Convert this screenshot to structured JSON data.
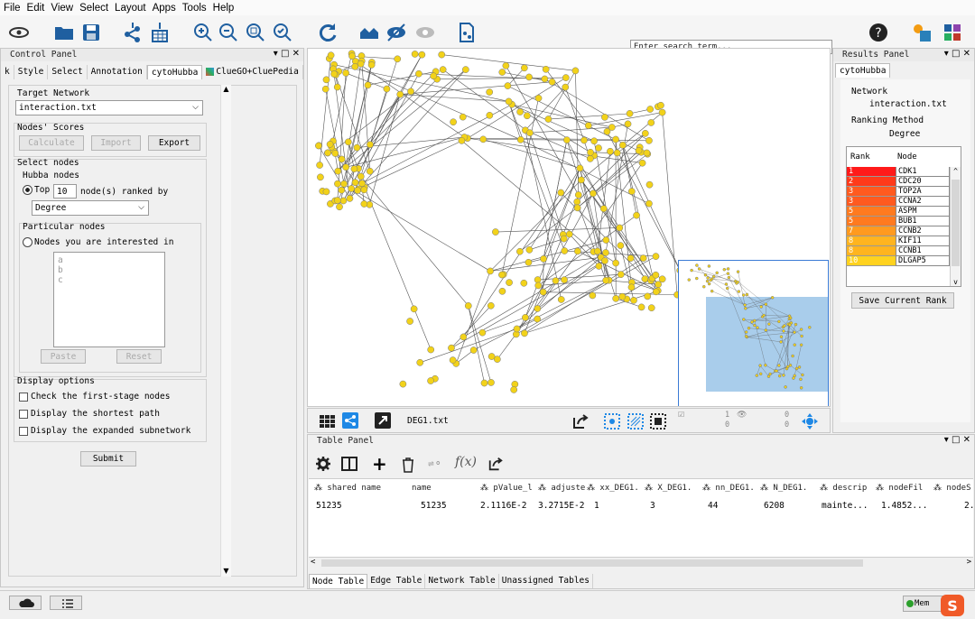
{
  "menu": [
    "File",
    "Edit",
    "View",
    "Select",
    "Layout",
    "Apps",
    "Tools",
    "Help"
  ],
  "search": {
    "placeholder": "Enter search term..."
  },
  "control_panel": {
    "title": "Control Panel",
    "tabs": [
      "k",
      "Style",
      "Select",
      "Annotation",
      "cytoHubba",
      "ClueGO+CluePedia"
    ],
    "target_network_label": "Target Network",
    "target_network_value": "interaction.txt",
    "nodes_scores_label": "Nodes' Scores",
    "calculate": "Calculate",
    "import": "Import",
    "export": "Export",
    "select_nodes_label": "Select nodes",
    "hubba_nodes_label": "Hubba nodes",
    "top_label": "Top",
    "top_value": "10",
    "ranked_by": "node(s) ranked by",
    "method": "Degree",
    "particular_nodes": "Particular nodes",
    "interested": "Nodes you are interested in",
    "list_items": [
      "a",
      "b",
      "c"
    ],
    "paste": "Paste",
    "reset": "Reset",
    "display_options": "Display options",
    "opt1": "Check the first-stage nodes",
    "opt2": "Display the shortest path",
    "opt3": "Display the expanded subnetwork",
    "submit": "Submit"
  },
  "network": {
    "name": "DEG1.txt",
    "sel_nodes": "1",
    "sel_edges": "0",
    "hidden_nodes": "0",
    "hidden_edges": "0"
  },
  "results": {
    "title": "Results Panel",
    "tab": "cytoHubba",
    "network_label": "Network",
    "network_value": "interaction.txt",
    "ranking_label": "Ranking Method",
    "ranking_value": "Degree",
    "col_rank": "Rank",
    "col_node": "Node",
    "rows": [
      {
        "rank": "1",
        "node": "CDK1",
        "color": "#ff1a1a"
      },
      {
        "rank": "2",
        "node": "CDC20",
        "color": "#ff3a1a"
      },
      {
        "rank": "3",
        "node": "TOP2A",
        "color": "#ff5a1f"
      },
      {
        "rank": "3",
        "node": "CCNA2",
        "color": "#ff5a1f"
      },
      {
        "rank": "5",
        "node": "ASPM",
        "color": "#ff7a1f"
      },
      {
        "rank": "5",
        "node": "BUB1",
        "color": "#ff7a1f"
      },
      {
        "rank": "7",
        "node": "CCNB2",
        "color": "#ff9a1f"
      },
      {
        "rank": "8",
        "node": "KIF11",
        "color": "#ffb41f"
      },
      {
        "rank": "8",
        "node": "CCNB1",
        "color": "#ffb41f"
      },
      {
        "rank": "10",
        "node": "DLGAP5",
        "color": "#ffd21f"
      }
    ],
    "save": "Save Current Rank"
  },
  "table_panel": {
    "title": "Table Panel",
    "headers": [
      "shared name",
      "name",
      "pValue_l",
      "adjuste",
      "xx_DEG1.",
      "X_DEG1.",
      "nn_DEG1.",
      "N_DEG1.",
      "descrip",
      "nodeFil",
      "nodeS"
    ],
    "row": [
      "51235",
      "51235",
      "2.1116E-2",
      "3.2715E-2",
      "1",
      "3",
      "44",
      "6208",
      "mainte...",
      "1.4852...",
      "2."
    ],
    "tabs": [
      "Node Table",
      "Edge Table",
      "Network Table",
      "Unassigned Tables"
    ]
  },
  "status": {
    "memory": "Mem"
  },
  "colors": {
    "node": "#f2d21a",
    "viewport": "#a9cdeb",
    "selection_border": "#3a7bd5"
  }
}
